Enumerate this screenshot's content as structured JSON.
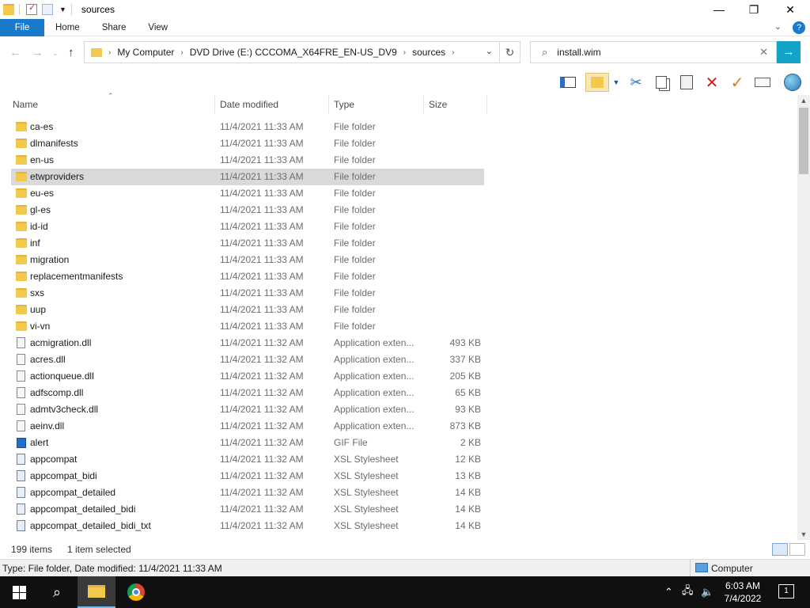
{
  "window": {
    "title": "sources",
    "minimize": "—",
    "maximize": "❐",
    "close": "✕"
  },
  "ribbon": {
    "tabs": [
      "File",
      "Home",
      "Share",
      "View"
    ],
    "expand_icon": "chevron-down-icon",
    "help_label": "?"
  },
  "address": {
    "breadcrumbs": [
      "My Computer",
      "DVD Drive (E:) CCCOMA_X64FRE_EN-US_DV9",
      "sources"
    ],
    "search_value": "install.wim"
  },
  "columns": {
    "name": "Name",
    "date": "Date modified",
    "type": "Type",
    "size": "Size"
  },
  "files": [
    {
      "name": "ca-es",
      "date": "11/4/2021 11:33 AM",
      "type": "File folder",
      "size": "",
      "kind": "folder"
    },
    {
      "name": "dlmanifests",
      "date": "11/4/2021 11:33 AM",
      "type": "File folder",
      "size": "",
      "kind": "folder"
    },
    {
      "name": "en-us",
      "date": "11/4/2021 11:33 AM",
      "type": "File folder",
      "size": "",
      "kind": "folder"
    },
    {
      "name": "etwproviders",
      "date": "11/4/2021 11:33 AM",
      "type": "File folder",
      "size": "",
      "kind": "folder",
      "selected": true
    },
    {
      "name": "eu-es",
      "date": "11/4/2021 11:33 AM",
      "type": "File folder",
      "size": "",
      "kind": "folder"
    },
    {
      "name": "gl-es",
      "date": "11/4/2021 11:33 AM",
      "type": "File folder",
      "size": "",
      "kind": "folder"
    },
    {
      "name": "id-id",
      "date": "11/4/2021 11:33 AM",
      "type": "File folder",
      "size": "",
      "kind": "folder"
    },
    {
      "name": "inf",
      "date": "11/4/2021 11:33 AM",
      "type": "File folder",
      "size": "",
      "kind": "folder"
    },
    {
      "name": "migration",
      "date": "11/4/2021 11:33 AM",
      "type": "File folder",
      "size": "",
      "kind": "folder"
    },
    {
      "name": "replacementmanifests",
      "date": "11/4/2021 11:33 AM",
      "type": "File folder",
      "size": "",
      "kind": "folder"
    },
    {
      "name": "sxs",
      "date": "11/4/2021 11:33 AM",
      "type": "File folder",
      "size": "",
      "kind": "folder"
    },
    {
      "name": "uup",
      "date": "11/4/2021 11:33 AM",
      "type": "File folder",
      "size": "",
      "kind": "folder"
    },
    {
      "name": "vi-vn",
      "date": "11/4/2021 11:33 AM",
      "type": "File folder",
      "size": "",
      "kind": "folder"
    },
    {
      "name": "acmigration.dll",
      "date": "11/4/2021 11:32 AM",
      "type": "Application exten...",
      "size": "493 KB",
      "kind": "file"
    },
    {
      "name": "acres.dll",
      "date": "11/4/2021 11:32 AM",
      "type": "Application exten...",
      "size": "337 KB",
      "kind": "file"
    },
    {
      "name": "actionqueue.dll",
      "date": "11/4/2021 11:32 AM",
      "type": "Application exten...",
      "size": "205 KB",
      "kind": "file"
    },
    {
      "name": "adfscomp.dll",
      "date": "11/4/2021 11:32 AM",
      "type": "Application exten...",
      "size": "65 KB",
      "kind": "file"
    },
    {
      "name": "admtv3check.dll",
      "date": "11/4/2021 11:32 AM",
      "type": "Application exten...",
      "size": "93 KB",
      "kind": "file"
    },
    {
      "name": "aeinv.dll",
      "date": "11/4/2021 11:32 AM",
      "type": "Application exten...",
      "size": "873 KB",
      "kind": "file"
    },
    {
      "name": "alert",
      "date": "11/4/2021 11:32 AM",
      "type": "GIF File",
      "size": "2 KB",
      "kind": "gif"
    },
    {
      "name": "appcompat",
      "date": "11/4/2021 11:32 AM",
      "type": "XSL Stylesheet",
      "size": "12 KB",
      "kind": "xsl"
    },
    {
      "name": "appcompat_bidi",
      "date": "11/4/2021 11:32 AM",
      "type": "XSL Stylesheet",
      "size": "13 KB",
      "kind": "xsl"
    },
    {
      "name": "appcompat_detailed",
      "date": "11/4/2021 11:32 AM",
      "type": "XSL Stylesheet",
      "size": "14 KB",
      "kind": "xsl"
    },
    {
      "name": "appcompat_detailed_bidi",
      "date": "11/4/2021 11:32 AM",
      "type": "XSL Stylesheet",
      "size": "14 KB",
      "kind": "xsl"
    },
    {
      "name": "appcompat_detailed_bidi_txt",
      "date": "11/4/2021 11:32 AM",
      "type": "XSL Stylesheet",
      "size": "14 KB",
      "kind": "xsl"
    }
  ],
  "status": {
    "item_count": "199 items",
    "selection": "1 item selected"
  },
  "details": {
    "info": "Type: File folder, Date modified: 11/4/2021 11:33 AM",
    "zone": "Computer"
  },
  "taskbar": {
    "time": "6:03 AM",
    "date": "7/4/2022",
    "notification_count": "1"
  },
  "colors": {
    "accent": "#1979ca",
    "folder": "#f2c94c",
    "selection": "#d9d9d9",
    "search_go": "#12a3c6"
  }
}
